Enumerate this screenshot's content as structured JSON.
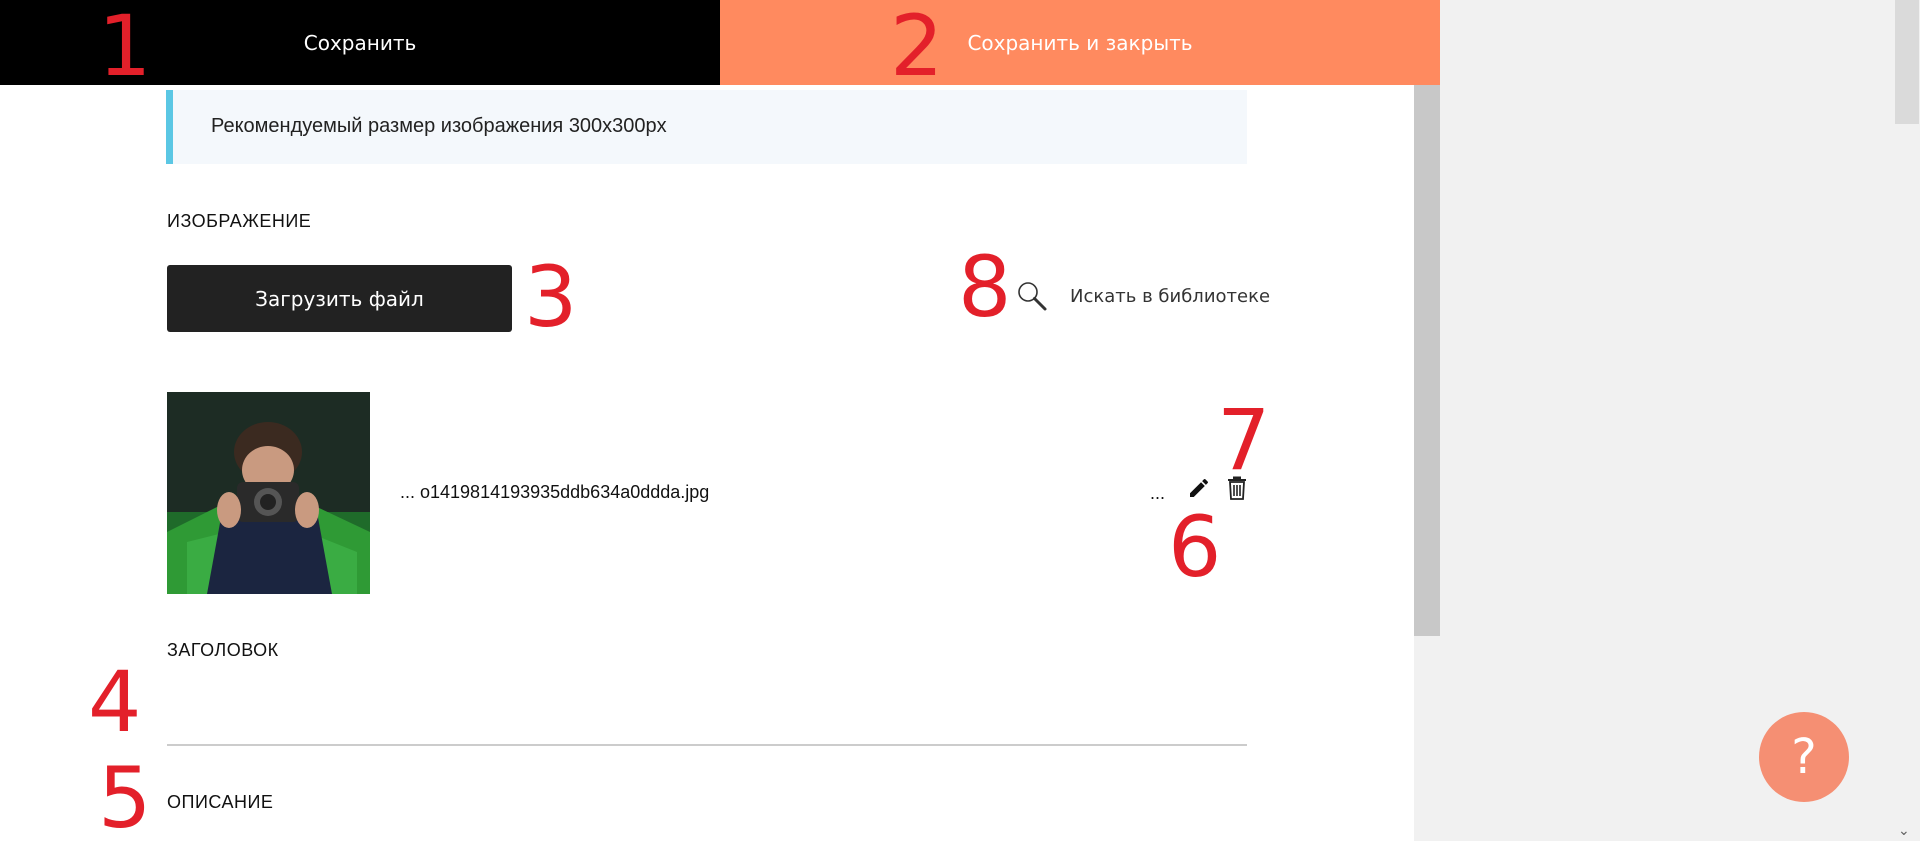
{
  "toolbar": {
    "save_label": "Сохранить",
    "save_close_label": "Сохранить и закрыть"
  },
  "notice": {
    "text": "Рекомендуемый размер изображения 300x300px"
  },
  "image_section": {
    "label": "ИЗОБРАЖЕНИЕ",
    "upload_label": "Загрузить файл",
    "library_label": "Искать в библиотеке",
    "file_name": "... o1419814193935ddb634a0ddda.jpg",
    "more": "..."
  },
  "title_section": {
    "label": "ЗАГОЛОВОК"
  },
  "description_section": {
    "label": "ОПИСАНИЕ"
  },
  "annotations": [
    "1",
    "2",
    "3",
    "4",
    "5",
    "6",
    "7",
    "8"
  ],
  "help": {
    "label": "?"
  },
  "colors": {
    "save_bg": "#000000",
    "save_close_bg": "#ff8a5f",
    "notice_accent": "#5bc7e4",
    "help_bg": "#f58f73",
    "annotation": "#e3202a"
  }
}
